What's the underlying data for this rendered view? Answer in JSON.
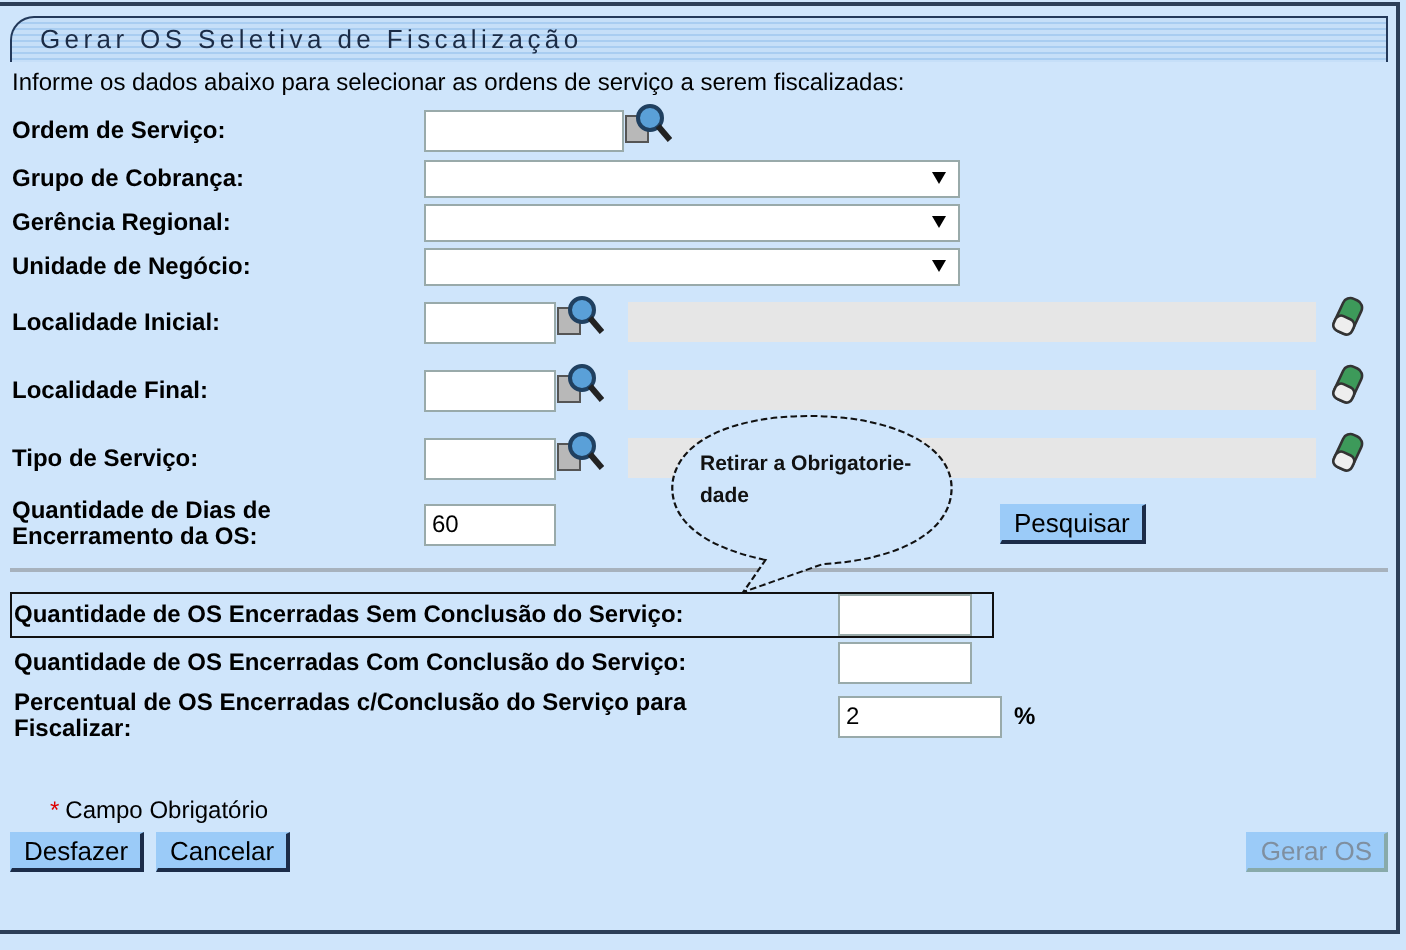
{
  "title": "Gerar OS Seletiva de Fiscalização",
  "instructions": "Informe os dados abaixo para selecionar as ordens de serviço a serem fiscalizadas:",
  "filters": [
    {
      "kind": "search_input",
      "label": "Ordem de Serviço:"
    },
    {
      "kind": "select",
      "label": "Grupo de Cobrança:"
    },
    {
      "kind": "select",
      "label": "Gerência Regional:"
    },
    {
      "kind": "select",
      "label": "Unidade de Negócio:"
    },
    {
      "kind": "lookup",
      "label": "Localidade Inicial:"
    },
    {
      "kind": "lookup",
      "label": "Localidade Final:"
    },
    {
      "kind": "lookup",
      "label": "Tipo de Serviço:"
    },
    {
      "kind": "text_input",
      "label": "Quantidade de Dias de Encerramento da OS:",
      "value": "60"
    }
  ],
  "search_button": "Pesquisar",
  "totals": [
    {
      "label": "Quantidade de OS Encerradas Sem Conclusão do Serviço:",
      "highlighted": true
    },
    {
      "label": "Quantidade de OS Encerradas Com Conclusão do Serviço:",
      "highlighted": false
    },
    {
      "label": "Percentual de OS Encerradas c/Conclusão do Serviço para Fiscalizar:",
      "value": "2",
      "unit": "%",
      "highlighted": false
    }
  ],
  "required_note": {
    "mark": "*",
    "text": "Campo Obrigatório"
  },
  "buttons": [
    {
      "label": "Desfazer",
      "disabled": false
    },
    {
      "label": "Cancelar",
      "disabled": false
    },
    {
      "label": "Gerar OS",
      "disabled": true
    }
  ],
  "callout": {
    "text": "Retirar a Obrigatorie-dade"
  }
}
